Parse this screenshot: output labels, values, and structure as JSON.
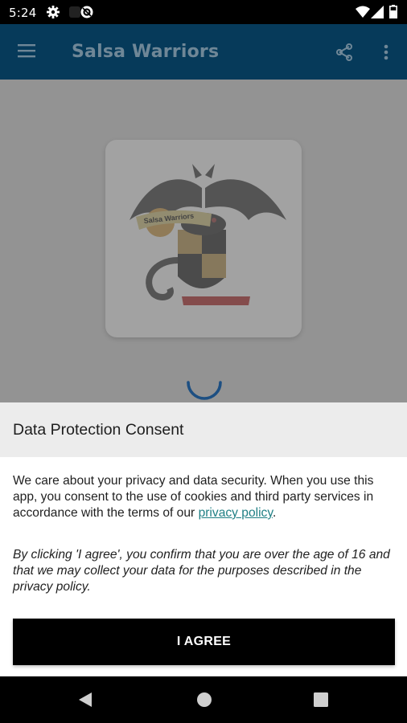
{
  "status_bar": {
    "time": "5:24",
    "icons": [
      "gear-icon",
      "no-sync-icon",
      "wifi-icon",
      "signal-icon",
      "battery-icon"
    ]
  },
  "app_bar": {
    "title": "Salsa Warriors",
    "menu_icon": "menu-icon",
    "share_icon": "share-icon",
    "more_icon": "more-vert-icon",
    "background_color": "#063a5a"
  },
  "content": {
    "logo": {
      "banner_text": "Salsa Warriors",
      "icon": "dragon-crest-logo"
    },
    "loading_icon": "spinner-icon",
    "accent_color": "#1565a8"
  },
  "consent": {
    "title": "Data Protection Consent",
    "paragraph1_text": "We care about your privacy and data security. When you use this app, you consent to the use of cookies and third party services in accordance with the terms of our ",
    "privacy_link": "privacy policy",
    "paragraph1_end": ".",
    "paragraph2": "By clicking 'I agree', you confirm that you are over the age of 16 and that we may collect your data for the purposes described in the privacy policy.",
    "agree_button": "I AGREE",
    "link_color": "#1f7f84"
  },
  "nav_bar": {
    "back_icon": "back-triangle-icon",
    "home_icon": "home-circle-icon",
    "recents_icon": "recents-square-icon"
  }
}
